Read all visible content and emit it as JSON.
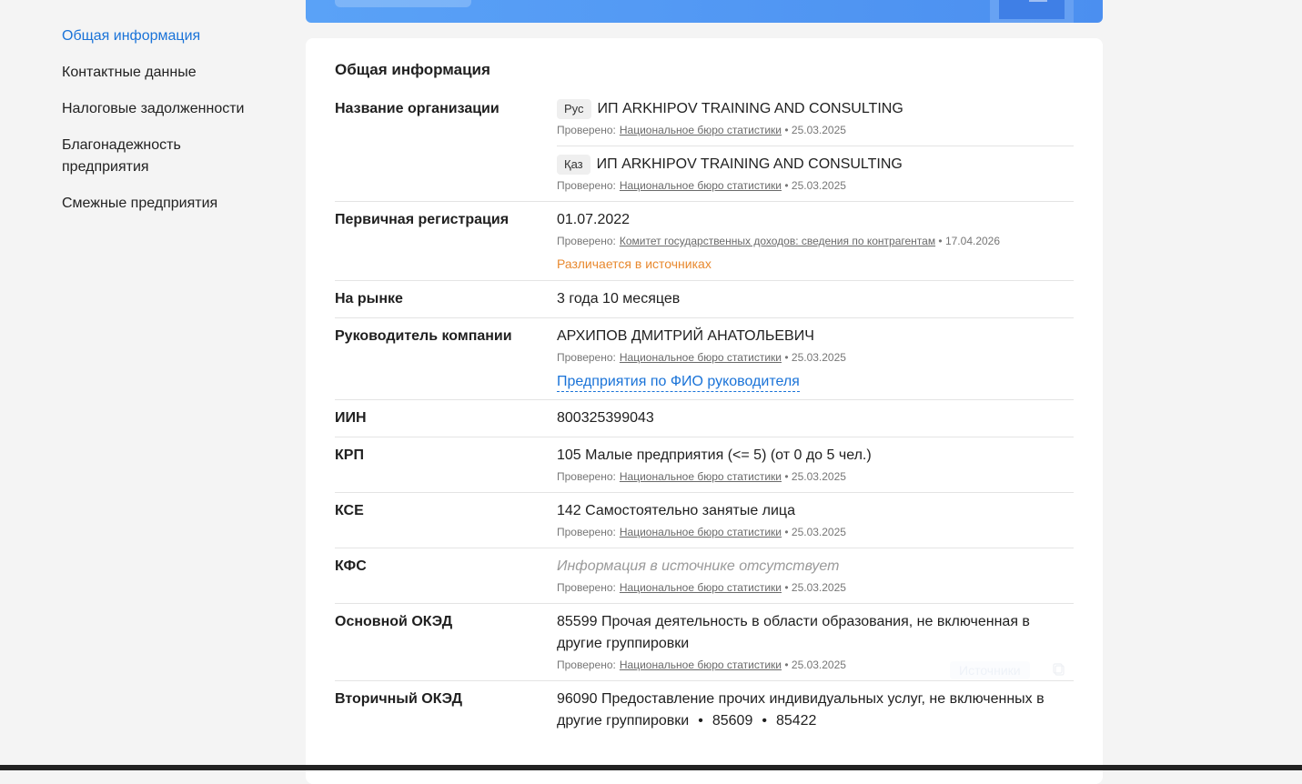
{
  "sidebar": {
    "items": [
      {
        "label": "Общая информация",
        "active": true
      },
      {
        "label": "Контактные данные"
      },
      {
        "label": "Налоговые задолженности"
      },
      {
        "label": "Благонадежность предприятия"
      },
      {
        "label": "Смежные предприятия"
      }
    ]
  },
  "card": {
    "title": "Общая информация",
    "checked_label": "Проверено:",
    "org_name": {
      "label": "Название организации",
      "ru": {
        "lang": "Рус",
        "value": "ИП ARKHIPOV TRAINING AND CONSULTING",
        "source": "Национальное бюро статистики",
        "date": "• 25.03.2025"
      },
      "kz": {
        "lang": "Қаз",
        "value": "ИП ARKHIPOV TRAINING AND CONSULTING",
        "source": "Национальное бюро статистики",
        "date": "• 25.03.2025"
      }
    },
    "registration": {
      "label": "Первичная регистрация",
      "value": "01.07.2022",
      "source": "Комитет государственных доходов: сведения по контрагентам",
      "date": "• 17.04.2026",
      "warning": "Различается в источниках"
    },
    "market": {
      "label": "На рынке",
      "value": "3 года 10 месяцев"
    },
    "director": {
      "label": "Руководитель компании",
      "value": "АРХИПОВ ДМИТРИЙ АНАТОЛЬЕВИЧ",
      "source": "Национальное бюро статистики",
      "date": "• 25.03.2025",
      "link": "Предприятия по ФИО руководителя"
    },
    "iin": {
      "label": "ИИН",
      "value": "800325399043"
    },
    "krp": {
      "label": "КРП",
      "value": "105 Малые предприятия (<= 5) (от 0 до 5 чел.)",
      "source": "Национальное бюро статистики",
      "date": "• 25.03.2025"
    },
    "kse": {
      "label": "КСЕ",
      "value": "142 Самостоятельно занятые лица",
      "source": "Национальное бюро статистики",
      "date": "• 25.03.2025"
    },
    "kfs": {
      "label": "КФС",
      "value": "Информация в источнике отсутствует",
      "source": "Национальное бюро статистики",
      "date": "• 25.03.2025"
    },
    "okved_main": {
      "label": "Основной ОКЭД",
      "value": "85599 Прочая деятельность в области образования, не включенная в другие группировки",
      "source": "Национальное бюро статистики",
      "date": "• 25.03.2025",
      "sources_button": "Источники"
    },
    "okved_secondary": {
      "label": "Вторичный ОКЭД",
      "value": "96090 Предоставление прочих индивидуальных услуг, не включенных в другие группировки",
      "extra1": "85609",
      "extra2": "85422"
    }
  }
}
